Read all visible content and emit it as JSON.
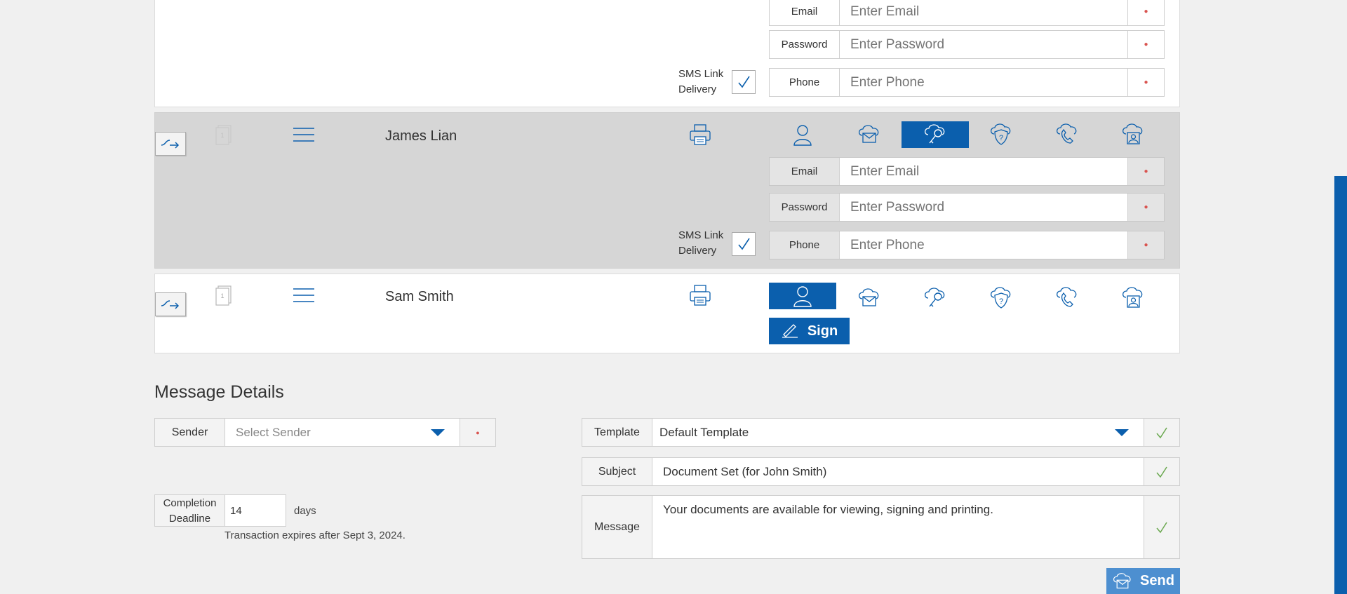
{
  "signers": [
    {
      "name": "",
      "fields": {
        "email_label": "Email",
        "email_placeholder": "Enter Email",
        "password_label": "Password",
        "password_placeholder": "Enter Password",
        "phone_label": "Phone",
        "phone_placeholder": "Enter Phone"
      },
      "sms_label_line1": "SMS Link",
      "sms_label_line2": "Delivery",
      "sms_checked": true
    },
    {
      "name": "James Lian",
      "page_count": "1",
      "fields": {
        "email_label": "Email",
        "email_placeholder": "Enter Email",
        "password_label": "Password",
        "password_placeholder": "Enter Password",
        "phone_label": "Phone",
        "phone_placeholder": "Enter Phone"
      },
      "sms_label_line1": "SMS Link",
      "sms_label_line2": "Delivery",
      "sms_checked": true,
      "active_role": "key-icon"
    },
    {
      "name": "Sam Smith",
      "page_count": "1",
      "active_role": "person-icon",
      "sign_label": "Sign"
    }
  ],
  "role_icons": [
    "person-icon",
    "cloud-mail-icon",
    "key-icon",
    "shield-question-icon",
    "phone-icon",
    "cloud-person-icon"
  ],
  "message": {
    "heading": "Message Details",
    "sender_label": "Sender",
    "sender_placeholder": "Select Sender",
    "template_label": "Template",
    "template_value": "Default Template",
    "subject_label": "Subject",
    "subject_value": "Document Set (for John Smith)",
    "message_label": "Message",
    "message_value": "Your documents are available for viewing, signing and printing.",
    "completion_label_line1": "Completion",
    "completion_label_line2": "Deadline",
    "completion_value": "14",
    "completion_unit": "days",
    "expiry_text": "Transaction expires after Sept 3, 2024.",
    "send_label": "Send"
  },
  "colors": {
    "accent": "#0b5fad",
    "send": "#4d8fd0",
    "required": "#d9534f",
    "valid": "#6aa84f",
    "highlight_row": "#d6d6d6"
  }
}
